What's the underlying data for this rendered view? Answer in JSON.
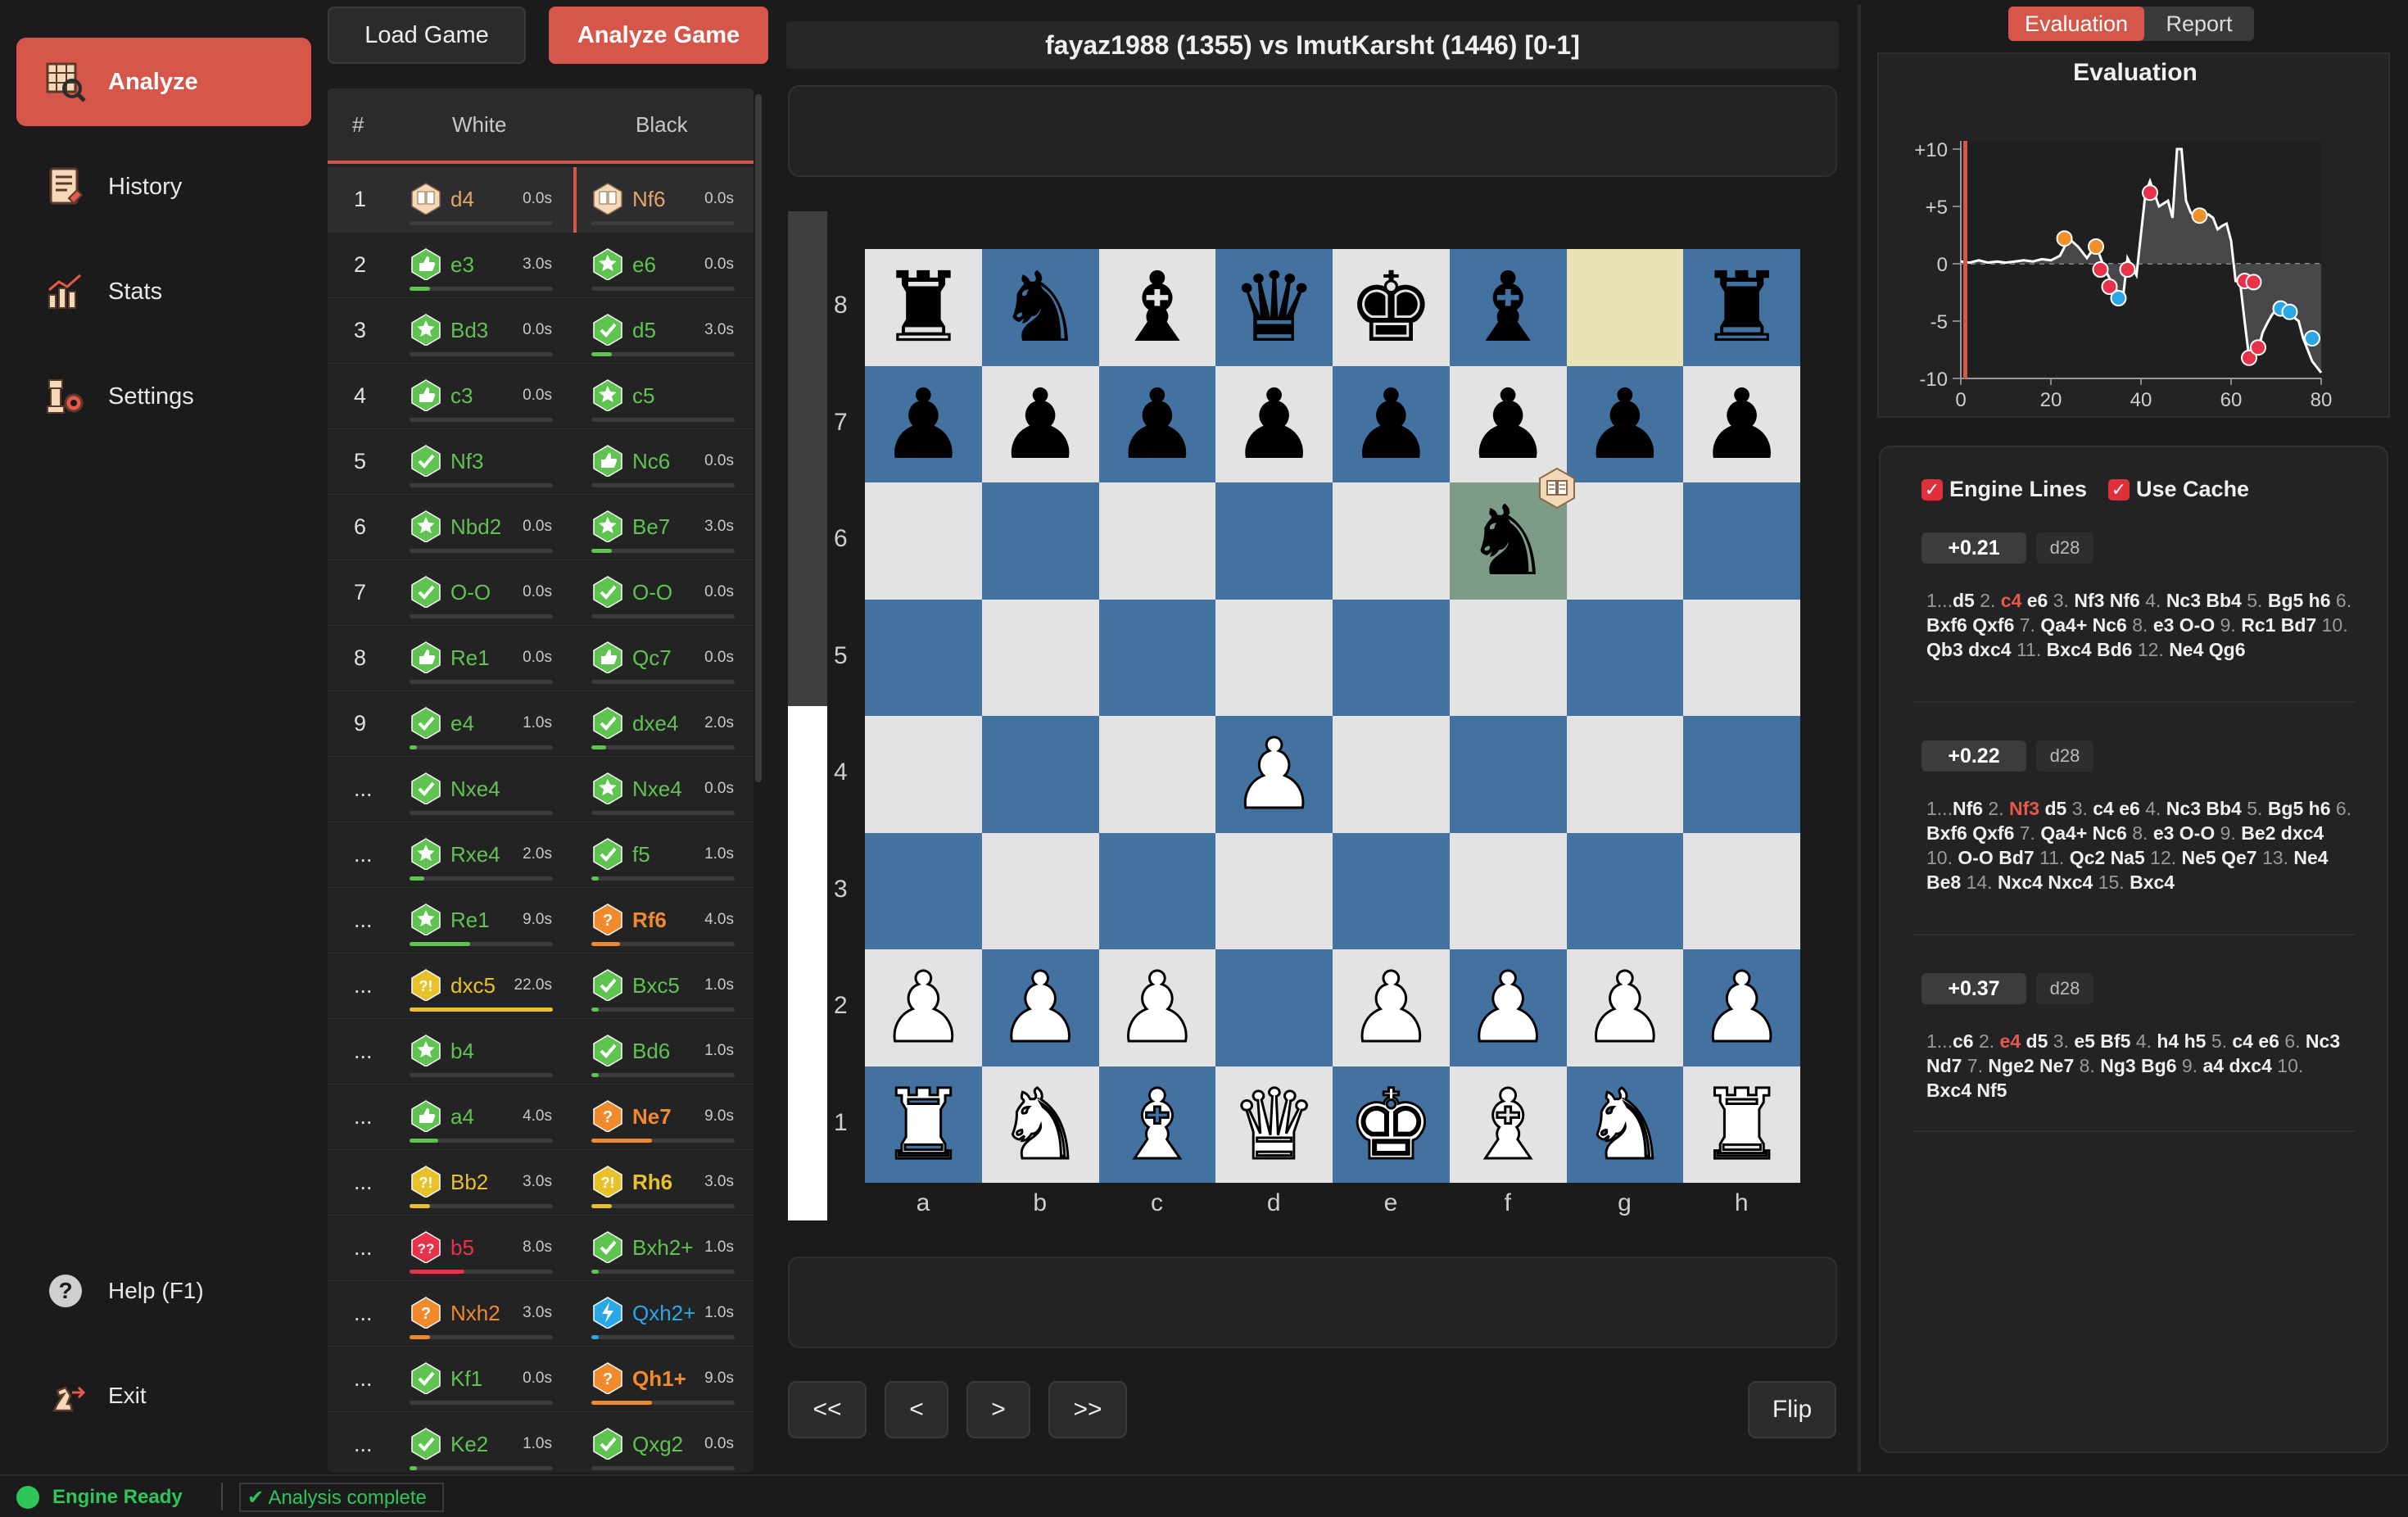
{
  "sidebar": {
    "items": [
      {
        "label": "Analyze",
        "icon": "analyze-icon"
      },
      {
        "label": "History",
        "icon": "history-icon"
      },
      {
        "label": "Stats",
        "icon": "stats-icon"
      },
      {
        "label": "Settings",
        "icon": "settings-icon"
      }
    ],
    "help": "Help (F1)",
    "exit": "Exit"
  },
  "toolbar": {
    "load": "Load Game",
    "analyze": "Analyze Game"
  },
  "movelist": {
    "headers": {
      "num": "#",
      "white": "White",
      "black": "Black"
    },
    "rows": [
      {
        "n": "1",
        "w": {
          "san": "d4",
          "t": "0.0s",
          "k": "book",
          "c": "#e4a56b",
          "b": 0
        },
        "b": {
          "san": "Nf6",
          "t": "0.0s",
          "k": "book",
          "c": "#e4a56b",
          "b": 0
        }
      },
      {
        "n": "2",
        "w": {
          "san": "e3",
          "t": "3.0s",
          "k": "good",
          "c": "#5fc44f",
          "b": 0.14
        },
        "b": {
          "san": "e6",
          "t": "0.0s",
          "k": "best",
          "c": "#5fc44f",
          "b": 0
        }
      },
      {
        "n": "3",
        "w": {
          "san": "Bd3",
          "t": "0.0s",
          "k": "best",
          "c": "#5fc44f",
          "b": 0
        },
        "b": {
          "san": "d5",
          "t": "3.0s",
          "k": "excellent",
          "c": "#5fc44f",
          "b": 0.14
        }
      },
      {
        "n": "4",
        "w": {
          "san": "c3",
          "t": "0.0s",
          "k": "good",
          "c": "#5fc44f",
          "b": 0
        },
        "b": {
          "san": "c5",
          "t": "",
          "k": "best",
          "c": "#5fc44f",
          "b": 0
        }
      },
      {
        "n": "5",
        "w": {
          "san": "Nf3",
          "t": "",
          "k": "excellent",
          "c": "#5fc44f",
          "b": 0
        },
        "b": {
          "san": "Nc6",
          "t": "0.0s",
          "k": "good",
          "c": "#5fc44f",
          "b": 0
        }
      },
      {
        "n": "6",
        "w": {
          "san": "Nbd2",
          "t": "0.0s",
          "k": "best",
          "c": "#5fc44f",
          "b": 0
        },
        "b": {
          "san": "Be7",
          "t": "3.0s",
          "k": "best",
          "c": "#5fc44f",
          "b": 0.14
        }
      },
      {
        "n": "7",
        "w": {
          "san": "O-O",
          "t": "0.0s",
          "k": "excellent",
          "c": "#5fc44f",
          "b": 0
        },
        "b": {
          "san": "O-O",
          "t": "0.0s",
          "k": "excellent",
          "c": "#5fc44f",
          "b": 0
        }
      },
      {
        "n": "8",
        "w": {
          "san": "Re1",
          "t": "0.0s",
          "k": "good",
          "c": "#5fc44f",
          "b": 0
        },
        "b": {
          "san": "Qc7",
          "t": "0.0s",
          "k": "good",
          "c": "#5fc44f",
          "b": 0
        }
      },
      {
        "n": "9",
        "w": {
          "san": "e4",
          "t": "1.0s",
          "k": "excellent",
          "c": "#5fc44f",
          "b": 0.05
        },
        "b": {
          "san": "dxe4",
          "t": "2.0s",
          "k": "excellent",
          "c": "#5fc44f",
          "b": 0.1
        }
      },
      {
        "n": "...",
        "w": {
          "san": "Nxe4",
          "t": "",
          "k": "excellent",
          "c": "#5fc44f",
          "b": 0
        },
        "b": {
          "san": "Nxe4",
          "t": "0.0s",
          "k": "best",
          "c": "#5fc44f",
          "b": 0
        }
      },
      {
        "n": "...",
        "w": {
          "san": "Rxe4",
          "t": "2.0s",
          "k": "best",
          "c": "#5fc44f",
          "b": 0.1
        },
        "b": {
          "san": "f5",
          "t": "1.0s",
          "k": "excellent",
          "c": "#5fc44f",
          "b": 0.05
        }
      },
      {
        "n": "...",
        "w": {
          "san": "Re1",
          "t": "9.0s",
          "k": "best",
          "c": "#5fc44f",
          "b": 0.42
        },
        "b": {
          "san": "Rf6",
          "t": "4.0s",
          "k": "mistake",
          "c": "#f08a2c",
          "b": 0.2
        }
      },
      {
        "n": "...",
        "w": {
          "san": "dxc5",
          "t": "22.0s",
          "k": "inaccuracy",
          "c": "#e8c22a",
          "b": 1
        },
        "b": {
          "san": "Bxc5",
          "t": "1.0s",
          "k": "excellent",
          "c": "#5fc44f",
          "b": 0.05
        }
      },
      {
        "n": "...",
        "w": {
          "san": "b4",
          "t": "",
          "k": "best",
          "c": "#5fc44f",
          "b": 0
        },
        "b": {
          "san": "Bd6",
          "t": "1.0s",
          "k": "excellent",
          "c": "#5fc44f",
          "b": 0.05
        }
      },
      {
        "n": "...",
        "w": {
          "san": "a4",
          "t": "4.0s",
          "k": "good",
          "c": "#5fc44f",
          "b": 0.2
        },
        "b": {
          "san": "Ne7",
          "t": "9.0s",
          "k": "mistake",
          "c": "#f08a2c",
          "b": 0.42
        }
      },
      {
        "n": "...",
        "w": {
          "san": "Bb2",
          "t": "3.0s",
          "k": "inaccuracy",
          "c": "#e8c22a",
          "b": 0.14
        },
        "b": {
          "san": "Rh6",
          "t": "3.0s",
          "k": "inaccuracy",
          "c": "#e8c22a",
          "b": 0.14
        }
      },
      {
        "n": "...",
        "w": {
          "san": "b5",
          "t": "8.0s",
          "k": "blunder",
          "c": "#e8324a",
          "b": 0.38
        },
        "b": {
          "san": "Bxh2+",
          "t": "1.0s",
          "k": "excellent",
          "c": "#5fc44f",
          "b": 0.05
        }
      },
      {
        "n": "...",
        "w": {
          "san": "Nxh2",
          "t": "3.0s",
          "k": "mistake",
          "c": "#f08a2c",
          "b": 0.14
        },
        "b": {
          "san": "Qxh2+",
          "t": "1.0s",
          "k": "brilliant",
          "c": "#29a8e8",
          "b": 0.05
        }
      },
      {
        "n": "...",
        "w": {
          "san": "Kf1",
          "t": "0.0s",
          "k": "excellent",
          "c": "#5fc44f",
          "b": 0
        },
        "b": {
          "san": "Qh1+",
          "t": "9.0s",
          "k": "mistake",
          "c": "#f08a2c",
          "b": 0.42
        }
      },
      {
        "n": "...",
        "w": {
          "san": "Ke2",
          "t": "1.0s",
          "k": "excellent",
          "c": "#5fc44f",
          "b": 0.05
        },
        "b": {
          "san": "Qxg2",
          "t": "0.0s",
          "k": "excellent",
          "c": "#5fc44f",
          "b": 0
        }
      }
    ]
  },
  "game": {
    "title": "fayaz1988 (1355) vs ImutKarsht (1446)  [0-1]"
  },
  "board": {
    "ranks": [
      "8",
      "7",
      "6",
      "5",
      "4",
      "3",
      "2",
      "1"
    ],
    "files": [
      "a",
      "b",
      "c",
      "d",
      "e",
      "f",
      "g",
      "h"
    ],
    "position": [
      [
        "r",
        "n",
        "b",
        "q",
        "k",
        "b",
        "",
        "r"
      ],
      [
        "p",
        "p",
        "p",
        "p",
        "p",
        "p",
        "p",
        "p"
      ],
      [
        "",
        "",
        "",
        "",
        "",
        "n",
        "",
        ""
      ],
      [
        "",
        "",
        "",
        "",
        "",
        "",
        "",
        ""
      ],
      [
        "",
        "",
        "",
        "P",
        "",
        "",
        "",
        ""
      ],
      [
        "",
        "",
        "",
        "",
        "",
        "",
        "",
        ""
      ],
      [
        "P",
        "P",
        "P",
        "",
        "P",
        "P",
        "P",
        "P"
      ],
      [
        "R",
        "N",
        "B",
        "Q",
        "K",
        "B",
        "N",
        "R"
      ]
    ],
    "last_move_from": "g8",
    "last_move_to": "f6",
    "eval_white_fraction": 0.51
  },
  "nav": {
    "first": "<<",
    "prev": "<",
    "next": ">",
    "last": ">>",
    "flip": "Flip"
  },
  "right": {
    "tabs": [
      "Evaluation",
      "Report"
    ],
    "engine_lines_label": "Engine Lines",
    "use_cache_label": "Use Cache",
    "lines": [
      {
        "score": "+0.21",
        "depth": "d28",
        "pv": [
          [
            "1...",
            "n"
          ],
          [
            "d5 ",
            ""
          ],
          [
            "2. ",
            "n"
          ],
          [
            "c4 ",
            "hi"
          ],
          [
            "e6 ",
            ""
          ],
          [
            "3. ",
            "n"
          ],
          [
            "Nf3 Nf6 ",
            ""
          ],
          [
            "4. ",
            "n"
          ],
          [
            "Nc3 Bb4 ",
            ""
          ],
          [
            "5. ",
            "n"
          ],
          [
            "Bg5 h6 ",
            ""
          ],
          [
            "6. ",
            "n"
          ],
          [
            "Bxf6 Qxf6 ",
            ""
          ],
          [
            "7. ",
            "n"
          ],
          [
            "Qa4+ Nc6 ",
            ""
          ],
          [
            "8. ",
            "n"
          ],
          [
            "e3 O-O ",
            ""
          ],
          [
            "9. ",
            "n"
          ],
          [
            "Rc1 Bd7 ",
            ""
          ],
          [
            "10. ",
            "n"
          ],
          [
            "Qb3 dxc4 ",
            ""
          ],
          [
            "11. ",
            "n"
          ],
          [
            "Bxc4 Bd6 ",
            ""
          ],
          [
            "12. ",
            "n"
          ],
          [
            "Ne4 Qg6",
            ""
          ]
        ]
      },
      {
        "score": "+0.22",
        "depth": "d28",
        "pv": [
          [
            "1...",
            "n"
          ],
          [
            "Nf6 ",
            ""
          ],
          [
            "2. ",
            "n"
          ],
          [
            "Nf3 ",
            "hi"
          ],
          [
            "d5 ",
            ""
          ],
          [
            "3. ",
            "n"
          ],
          [
            "c4 e6 ",
            ""
          ],
          [
            "4. ",
            "n"
          ],
          [
            "Nc3 Bb4 ",
            ""
          ],
          [
            "5. ",
            "n"
          ],
          [
            "Bg5 h6 ",
            ""
          ],
          [
            "6. ",
            "n"
          ],
          [
            "Bxf6 Qxf6 ",
            ""
          ],
          [
            "7. ",
            "n"
          ],
          [
            "Qa4+ Nc6 ",
            ""
          ],
          [
            "8. ",
            "n"
          ],
          [
            "e3 O-O ",
            ""
          ],
          [
            "9. ",
            "n"
          ],
          [
            "Be2 dxc4 ",
            ""
          ],
          [
            "10. ",
            "n"
          ],
          [
            "O-O Bd7 ",
            ""
          ],
          [
            "11. ",
            "n"
          ],
          [
            "Qc2 Na5 ",
            ""
          ],
          [
            "12. ",
            "n"
          ],
          [
            "Ne5 Qe7 ",
            ""
          ],
          [
            "13. ",
            "n"
          ],
          [
            "Ne4 Be8 ",
            ""
          ],
          [
            "14. ",
            "n"
          ],
          [
            "Nxc4 Nxc4 ",
            ""
          ],
          [
            "15. ",
            "n"
          ],
          [
            "Bxc4",
            ""
          ]
        ]
      },
      {
        "score": "+0.37",
        "depth": "d28",
        "pv": [
          [
            "1...",
            "n"
          ],
          [
            "c6 ",
            ""
          ],
          [
            "2. ",
            "n"
          ],
          [
            "e4 ",
            "hi"
          ],
          [
            "d5 ",
            ""
          ],
          [
            "3. ",
            "n"
          ],
          [
            "e5 Bf5 ",
            ""
          ],
          [
            "4. ",
            "n"
          ],
          [
            "h4 h5 ",
            ""
          ],
          [
            "5. ",
            "n"
          ],
          [
            "c4 e6 ",
            ""
          ],
          [
            "6. ",
            "n"
          ],
          [
            "Nc3 Nd7 ",
            ""
          ],
          [
            "7. ",
            "n"
          ],
          [
            "Nge2 Ne7 ",
            ""
          ],
          [
            "8. ",
            "n"
          ],
          [
            "Ng3 Bg6 ",
            ""
          ],
          [
            "9. ",
            "n"
          ],
          [
            "a4 dxc4 ",
            ""
          ],
          [
            "10. ",
            "n"
          ],
          [
            "Bxc4 Nf5",
            ""
          ]
        ]
      }
    ]
  },
  "chart_data": {
    "type": "line",
    "title": "Evaluation",
    "xlim": [
      0,
      80
    ],
    "ylim": [
      -10,
      10
    ],
    "xticks": [
      "0",
      "20",
      "40",
      "60",
      "80"
    ],
    "yticks": [
      "+10",
      "+5",
      "0",
      "-5",
      "-10"
    ],
    "current_ply": 1,
    "x": [
      0,
      2,
      4,
      6,
      8,
      10,
      12,
      14,
      16,
      18,
      20,
      22,
      24,
      26,
      28,
      30,
      32,
      34,
      36,
      37,
      39,
      41,
      42,
      44,
      46,
      47,
      48,
      49,
      50,
      51,
      52,
      53,
      54,
      55,
      56,
      57,
      58,
      59,
      60,
      61,
      62,
      63,
      64,
      65,
      66,
      67,
      68,
      69,
      70,
      71,
      72,
      73,
      74,
      75,
      76,
      78,
      80
    ],
    "y": [
      0.2,
      0.1,
      0.3,
      0.1,
      0.2,
      0.1,
      0.2,
      0.3,
      0.2,
      0.4,
      0.3,
      0.7,
      2.2,
      1.5,
      0.5,
      1.6,
      -0.5,
      -2.0,
      -3.0,
      0.5,
      -1.0,
      6.2,
      7.2,
      5.0,
      5.5,
      4.0,
      10.0,
      10.0,
      5.5,
      4.5,
      4.0,
      4.2,
      4.2,
      4.3,
      4.0,
      3.0,
      3.3,
      3.5,
      2.0,
      -1.5,
      -1.6,
      -5.0,
      -8.2,
      -7.5,
      -7.5,
      -6.0,
      -5.2,
      -4.5,
      -4.0,
      -4.1,
      -4.3,
      -4.5,
      -4.7,
      -5.0,
      -6.5,
      -8.5,
      -9.5
    ],
    "markers": [
      {
        "x": 23,
        "y": 2.2,
        "color": "#f0902a"
      },
      {
        "x": 30,
        "y": 1.5,
        "color": "#f0902a"
      },
      {
        "x": 31,
        "y": -0.5,
        "color": "#e8324a"
      },
      {
        "x": 33,
        "y": -2.0,
        "color": "#e8324a"
      },
      {
        "x": 35,
        "y": -3.0,
        "color": "#29a8e8"
      },
      {
        "x": 37,
        "y": -0.5,
        "color": "#e8324a"
      },
      {
        "x": 42,
        "y": 6.2,
        "color": "#e8324a"
      },
      {
        "x": 53,
        "y": 4.2,
        "color": "#f0902a"
      },
      {
        "x": 63,
        "y": -1.5,
        "color": "#e8324a"
      },
      {
        "x": 65,
        "y": -1.6,
        "color": "#e8324a"
      },
      {
        "x": 64,
        "y": -8.2,
        "color": "#e8324a"
      },
      {
        "x": 66,
        "y": -7.3,
        "color": "#e8324a"
      },
      {
        "x": 71,
        "y": -3.9,
        "color": "#29a8e8"
      },
      {
        "x": 73,
        "y": -4.2,
        "color": "#29a8e8"
      },
      {
        "x": 78,
        "y": -6.5,
        "color": "#29a8e8"
      }
    ]
  },
  "status": {
    "engine": "Engine Ready",
    "analysis": "✔ Analysis complete"
  },
  "colors": {
    "accent": "#d6574a",
    "board_dark": "#4372a1",
    "board_light": "#e3e3e3"
  }
}
